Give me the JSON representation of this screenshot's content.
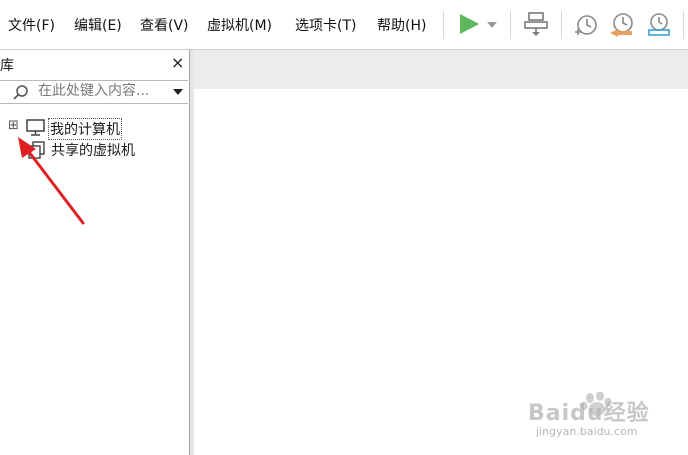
{
  "menu": {
    "items": [
      {
        "label": "文件(F)"
      },
      {
        "label": "编辑(E)"
      },
      {
        "label": "查看(V)"
      },
      {
        "label": "虚拟机(M)"
      },
      {
        "label": "选项卡(T)"
      },
      {
        "label": "帮助(H)"
      }
    ]
  },
  "toolbar": {
    "icons": [
      "play-icon",
      "dropdown-arrow-icon",
      "network-icon",
      "snapshot-icon",
      "revert-snapshot-icon",
      "manage-snapshots-icon"
    ],
    "play_color": "#5cb85c"
  },
  "library": {
    "title": "库",
    "close": "×",
    "search_placeholder": "在此处键入内容...",
    "tree": [
      {
        "label": "我的计算机",
        "expander": "⊞"
      },
      {
        "label": "共享的虚拟机"
      }
    ]
  },
  "annotation": {
    "arrow_color": "#e02020"
  },
  "watermark": {
    "text": "Baidu经验",
    "url_text": "jingyan.baidu.com"
  }
}
